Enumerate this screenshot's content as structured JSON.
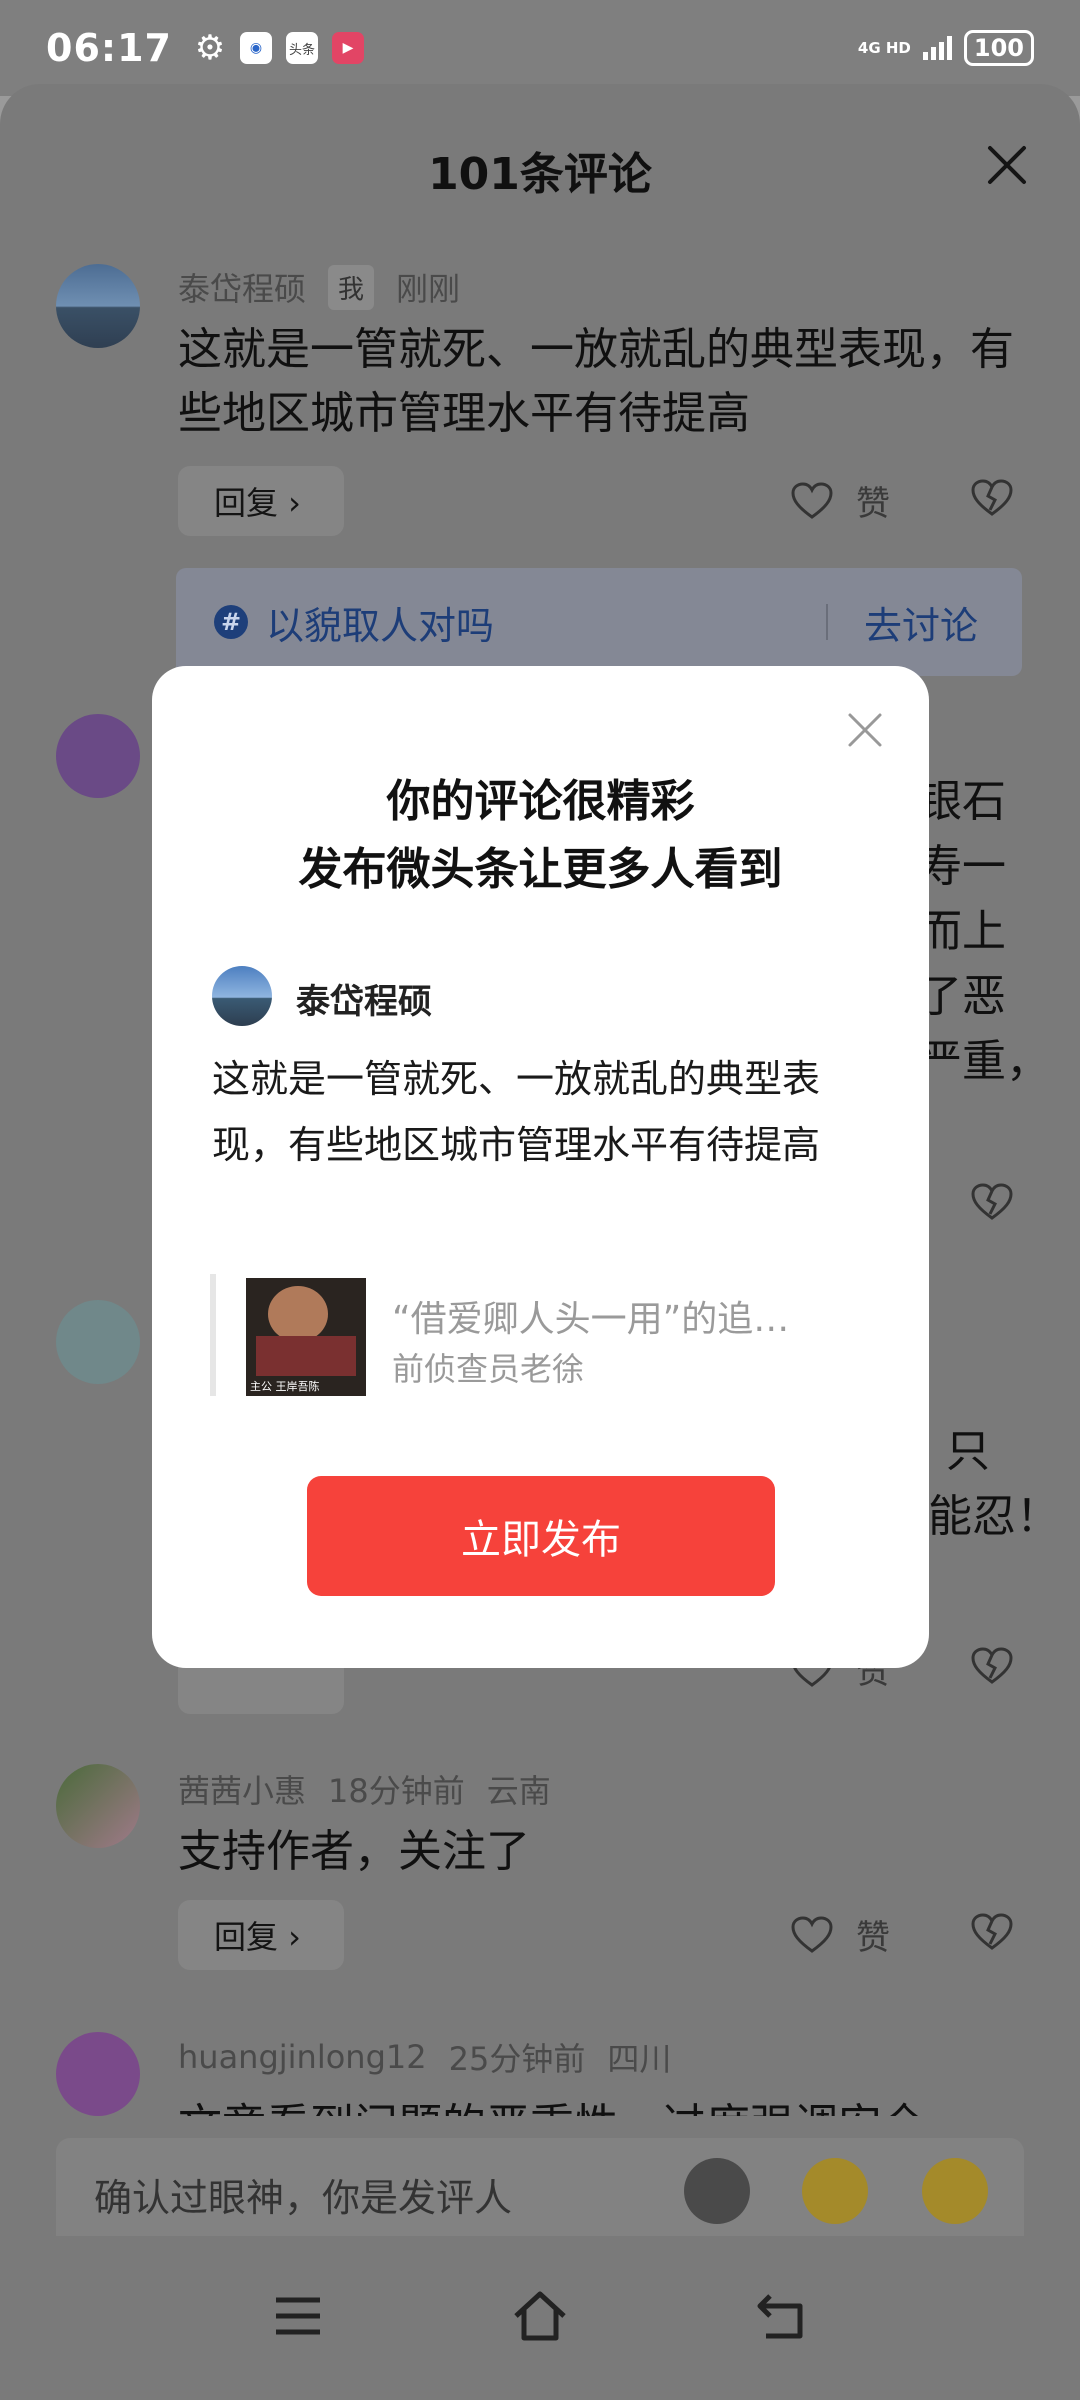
{
  "status_bar": {
    "time": "06:17",
    "icon_b_text": "头条",
    "network": "4G HD",
    "battery": "100"
  },
  "sheet": {
    "title": "101条评论"
  },
  "comments": [
    {
      "user": "泰岱程硕",
      "tag": "我",
      "time": "刚刚",
      "text": "这就是一管就死、一放就乱的典型表现，有些地区城市管理水平有待提高",
      "reply_label": "回复 ›",
      "like_label": "赞"
    },
    {
      "user": "茜茜小惠",
      "time": "18分钟前",
      "location": "云南",
      "text": "支持作者，关注了",
      "reply_label": "回复 ›",
      "like_label": "赞"
    },
    {
      "user": "huangjinlong12",
      "time": "25分钟前",
      "location": "四川",
      "text": "文章看到问题的严重性，过度强调安全"
    }
  ],
  "topic": {
    "text": "以貌取人对吗",
    "action": "去讨论"
  },
  "hidden_comment_fragments": [
    "银石",
    "寿一",
    "而上",
    "了恶",
    "严重，",
    "只",
    "能忍！",
    "赞"
  ],
  "input": {
    "placeholder": "确认过眼神，你是发评人"
  },
  "modal": {
    "title_line1": "你的评论很精彩",
    "title_line2": "发布微头条让更多人看到",
    "user": "泰岱程硕",
    "text": "这就是一管就死、一放就乱的典型表现，有些地区城市管理水平有待提高",
    "quote_title": "“借爱卿人头一用”的追…",
    "quote_author": "前侦查员老徐",
    "thumb_caption": "主公 王岸吾陈",
    "button": "立即发布"
  },
  "colors": {
    "accent_red": "#f6423b",
    "topic_blue": "#1d3d78"
  }
}
